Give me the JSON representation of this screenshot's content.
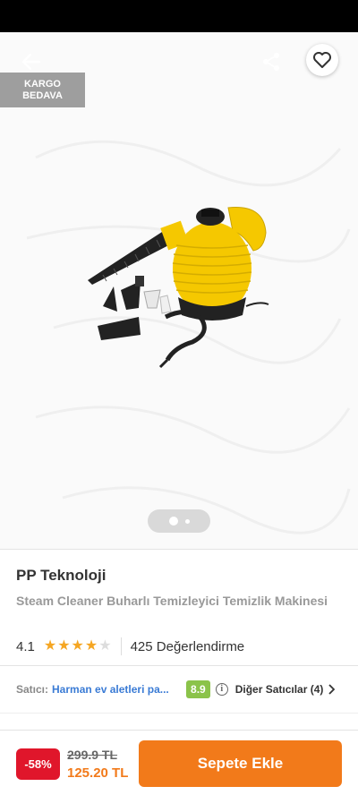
{
  "badge": {
    "line1": "KARGO",
    "line2": "BEDAVA"
  },
  "icons": {
    "back": "arrow-left-icon",
    "share": "share-icon",
    "favorite": "heart-icon",
    "info": "info-icon",
    "chevron": "chevron-right-icon"
  },
  "gallery": {
    "current_index": 1,
    "total": 2
  },
  "product": {
    "brand": "PP Teknoloji",
    "name": "Steam Cleaner Buharlı Temizleyici Temizlik Makinesi",
    "rating": "4.1",
    "stars_filled": 4,
    "stars_total": 5,
    "reviews_text": "425 Değerlendirme"
  },
  "seller": {
    "label": "Satıcı:",
    "name": "Harman ev aletleri pa...",
    "score": "8.9",
    "info_symbol": "i",
    "other_sellers": "Diğer Satıcılar (4)"
  },
  "pricing": {
    "discount": "-58%",
    "old_price": "299.9 TL",
    "new_price": "125.20 TL",
    "add_to_cart": "Sepete Ekle"
  },
  "colors": {
    "accent": "#f27a1a",
    "discount": "#e0162b",
    "score": "#8bc34a",
    "seller_link": "#3a7bd5",
    "star": "#f5a623",
    "product_yellow": "#f5c800"
  }
}
